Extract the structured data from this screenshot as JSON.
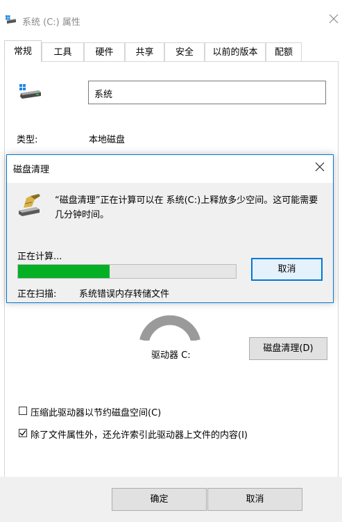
{
  "window": {
    "title": "系统 (C:) 属性",
    "tabs": [
      "常规",
      "工具",
      "硬件",
      "共享",
      "安全",
      "以前的版本",
      "配额"
    ],
    "active_tab": "常规"
  },
  "general": {
    "drive_name": "系统",
    "type_label": "类型:",
    "type_value": "本地磁盘",
    "drive_label": "驱动器 C:",
    "cleanup_button": "磁盘清理(D)",
    "compress_label": "压缩此驱动器以节约磁盘空间(C)",
    "compress_checked": false,
    "index_label": "除了文件属性外，还允许索引此驱动器上文件的内容(I)",
    "index_checked": true
  },
  "footer": {
    "ok": "确定",
    "cancel": "取消"
  },
  "dialog": {
    "title": "磁盘清理",
    "message": "“磁盘清理”正在计算可以在 系统(C:)上释放多少空间。这可能需要几分钟时间。",
    "calculating": "正在计算...",
    "progress": 0.42,
    "cancel": "取消",
    "scanning_label": "正在扫描:",
    "scanning_value": "系统错误内存转储文件"
  },
  "colors": {
    "accent": "#0078d7",
    "progress": "#06b025"
  }
}
